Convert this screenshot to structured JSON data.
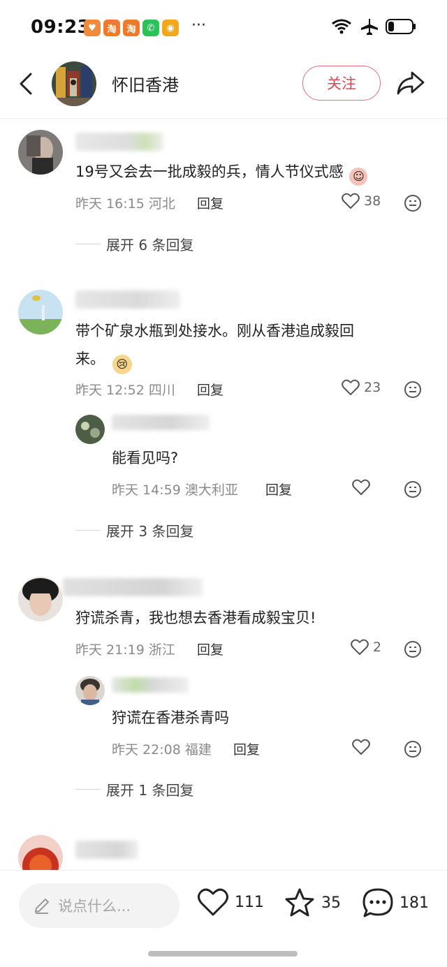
{
  "status_bar": {
    "time": "09:23",
    "app_icons": [
      {
        "name": "heart-app-icon",
        "glyph": "♥",
        "color": "#f08a3c"
      },
      {
        "name": "taobao-app-icon",
        "glyph": "淘",
        "color": "#f07a2a"
      },
      {
        "name": "taobao-app-icon-2",
        "glyph": "淘",
        "color": "#f07a2a"
      },
      {
        "name": "wechat-app-icon",
        "glyph": "✆",
        "color": "#2bc25a"
      },
      {
        "name": "weibo-app-icon",
        "glyph": "◉",
        "color": "#f3a71b"
      }
    ],
    "more": "···"
  },
  "header": {
    "title": "怀旧香港",
    "follow_label": "关注"
  },
  "comments": [
    {
      "text": "19号又会去一批成毅的兵，情人节仪式感",
      "time": "昨天 16:15",
      "location": "河北",
      "reply_label": "回复",
      "likes": "38",
      "expand_label": "展开 6 条回复"
    },
    {
      "text_line1": "带个矿泉水瓶到处接水。刚从香港追成毅回",
      "text_line2": "来。",
      "time": "昨天 12:52",
      "location": "四川",
      "reply_label": "回复",
      "likes": "23",
      "reply": {
        "text": "能看见吗?",
        "time": "昨天 14:59",
        "location": "澳大利亚",
        "reply_label": "回复"
      },
      "expand_label": "展开 3 条回复"
    },
    {
      "text": "狩谎杀青，我也想去香港看成毅宝贝!",
      "time": "昨天 21:19",
      "location": "浙江",
      "reply_label": "回复",
      "likes": "2",
      "reply": {
        "text": "狩谎在香港杀青吗",
        "time": "昨天 22:08",
        "location": "福建",
        "reply_label": "回复"
      },
      "expand_label": "展开 1 条回复"
    }
  ],
  "bottom_bar": {
    "input_placeholder": "说点什么...",
    "likes": "111",
    "favorites": "35",
    "comments": "181"
  },
  "colors": {
    "follow_red": "#e04552",
    "meta_gray": "#8a8a8a"
  }
}
